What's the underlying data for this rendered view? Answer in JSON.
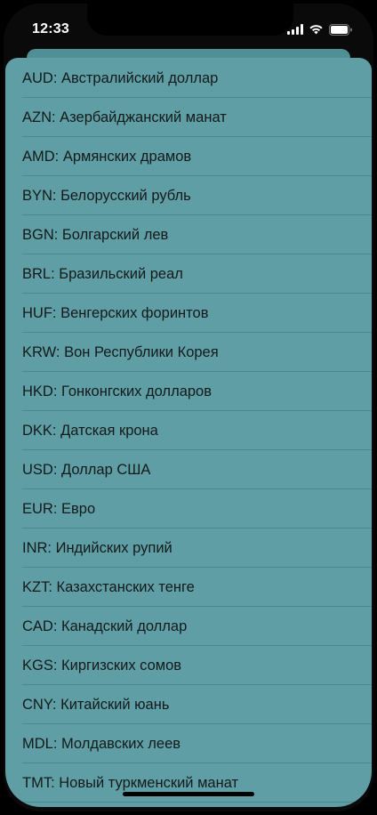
{
  "status_bar": {
    "time": "12:33"
  },
  "icons": {
    "signal": "cellular-signal-icon",
    "wifi": "wifi-icon",
    "battery": "battery-icon"
  },
  "colors": {
    "sheet_background": "#5e9ea4",
    "sheet_back_card": "#4f8f95",
    "row_text": "#141a1b",
    "device_background": "#000000"
  },
  "currencies": [
    "AUD:  Австралийский доллар",
    "AZN:  Азербайджанский манат",
    "AMD:  Армянских драмов",
    "BYN:  Белорусский рубль",
    "BGN:  Болгарский лев",
    "BRL:  Бразильский реал",
    "HUF:  Венгерских форинтов",
    "KRW:  Вон Республики Корея",
    "HKD:  Гонконгских долларов",
    "DKK:  Датская крона",
    "USD:  Доллар США",
    "EUR:  Евро",
    "INR:  Индийских рупий",
    "KZT:  Казахстанских тенге",
    "CAD:  Канадский доллар",
    "KGS:  Киргизских сомов",
    "CNY:  Китайский юань",
    "MDL:  Молдавских леев",
    "TMT:  Новый туркменский манат"
  ]
}
